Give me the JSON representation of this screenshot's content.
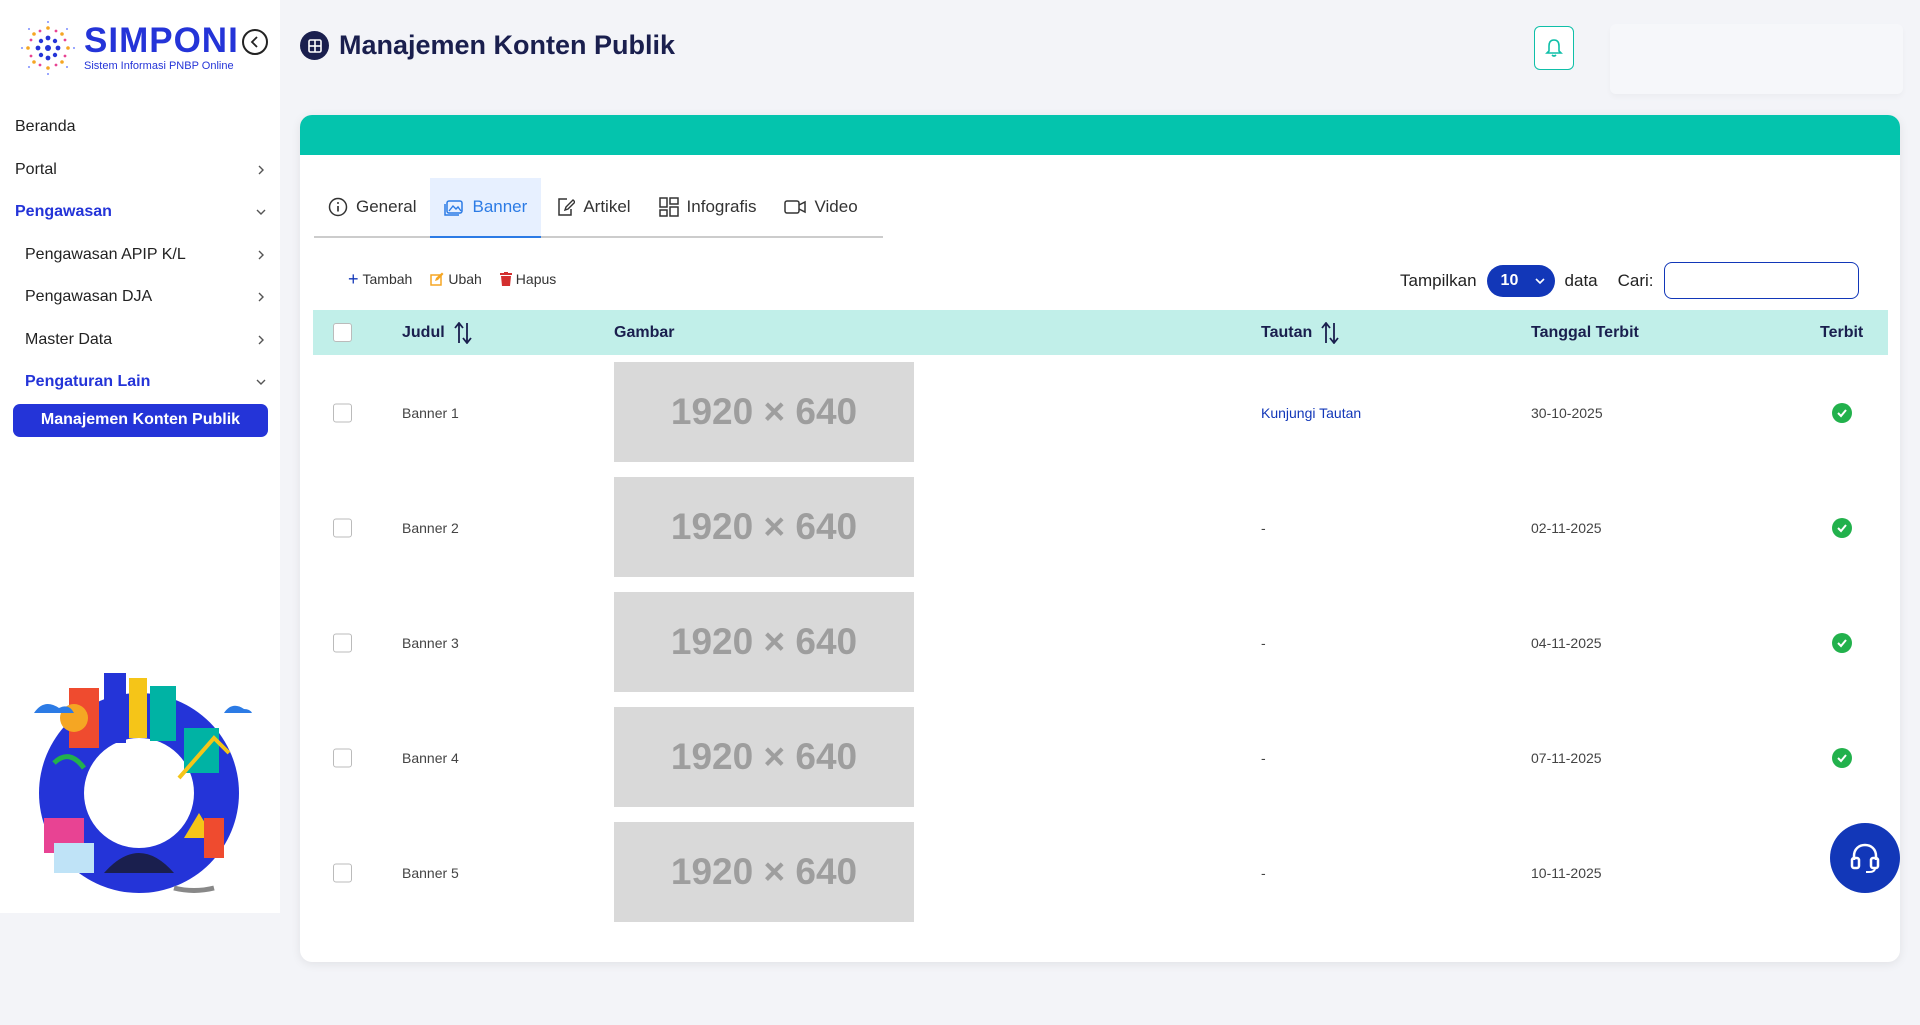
{
  "brand": {
    "title": "SIMPONI",
    "subtitle": "Sistem Informasi PNBP Online"
  },
  "sidebar": {
    "items": [
      {
        "label": "Beranda"
      },
      {
        "label": "Portal"
      },
      {
        "label": "Pengawasan"
      },
      {
        "label": "Pengawasan APIP K/L"
      },
      {
        "label": "Pengawasan DJA"
      },
      {
        "label": "Master Data"
      },
      {
        "label": "Pengaturan Lain"
      },
      {
        "label": "Manajemen Konten Publik"
      }
    ]
  },
  "header": {
    "title": "Manajemen Konten Publik"
  },
  "tabs": [
    {
      "label": "General"
    },
    {
      "label": "Banner"
    },
    {
      "label": "Artikel"
    },
    {
      "label": "Infografis"
    },
    {
      "label": "Video"
    }
  ],
  "toolbar": {
    "add": "Tambah",
    "edit": "Ubah",
    "delete": "Hapus"
  },
  "table_controls": {
    "show_label": "Tampilkan",
    "page_size": "10",
    "data_label": "data",
    "search_label": "Cari:"
  },
  "table": {
    "columns": {
      "title": "Judul",
      "image": "Gambar",
      "link": "Tautan",
      "date": "Tanggal Terbit",
      "published": "Terbit"
    },
    "rows": [
      {
        "title": "Banner 1",
        "image": "1920 × 640",
        "link": "Kunjungi Tautan",
        "date": "30-10-2025"
      },
      {
        "title": "Banner 2",
        "image": "1920 × 640",
        "link": "-",
        "date": "02-11-2025"
      },
      {
        "title": "Banner 3",
        "image": "1920 × 640",
        "link": "-",
        "date": "04-11-2025"
      },
      {
        "title": "Banner 4",
        "image": "1920 × 640",
        "link": "-",
        "date": "07-11-2025"
      },
      {
        "title": "Banner 5",
        "image": "1920 × 640",
        "link": "-",
        "date": "10-11-2025"
      }
    ]
  },
  "colors": {
    "brand": "#2434d8",
    "teal": "#04c4ad",
    "header_row": "#c1efe9",
    "success": "#22b14c"
  }
}
